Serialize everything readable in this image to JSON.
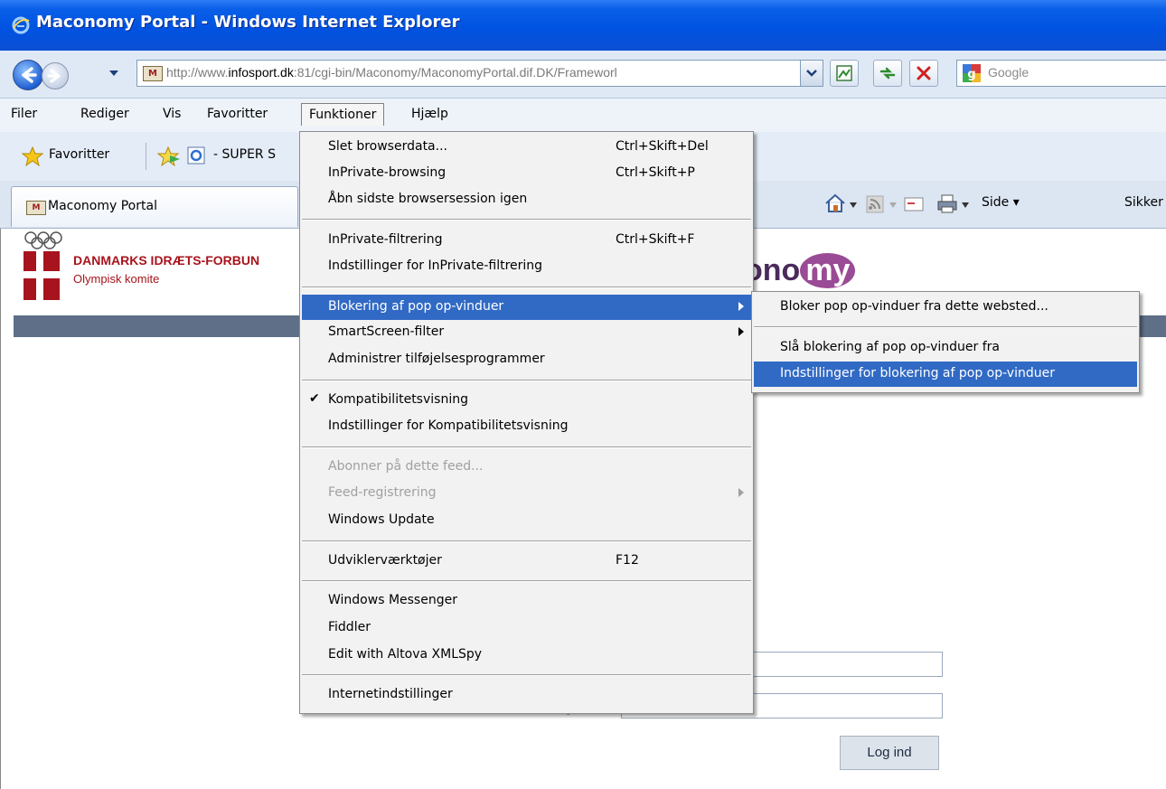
{
  "window": {
    "title": "Maconomy Portal - Windows Internet Explorer"
  },
  "address": {
    "url_prefix": "http://www.",
    "url_domain": "infosport.dk",
    "url_rest": ":81/cgi-bin/Maconomy/MaconomyPortal.dif.DK/Frameworl",
    "site_icon_text": "M",
    "search_placeholder": "Google"
  },
  "menubar": {
    "items": [
      "Filer",
      "Rediger",
      "Vis",
      "Favoritter",
      "Funktioner",
      "Hjælp"
    ]
  },
  "favorites": {
    "label": "Favoritter",
    "link": "- SUPER S"
  },
  "tab": {
    "label": "Maconomy Portal",
    "icon_text": "M"
  },
  "command_bar": {
    "page": "Side",
    "safety": "Sikker"
  },
  "page": {
    "org_name": "DANMARKS IDRÆTS-FORBUN",
    "org_sub": "Olympisk komite",
    "logo_prefix": "ono",
    "logo_suffix": "my",
    "login_button": "Log ind",
    "password_label_fragment": "g"
  },
  "menu": {
    "items": [
      {
        "label": "Slet browserdata...",
        "shortcut": "Ctrl+Skift+Del"
      },
      {
        "label": "InPrivate-browsing",
        "shortcut": "Ctrl+Skift+P"
      },
      {
        "label": "Åbn sidste browsersession igen",
        "shortcut": ""
      },
      {
        "label": "InPrivate-filtrering",
        "shortcut": "Ctrl+Skift+F"
      },
      {
        "label": "Indstillinger for InPrivate-filtrering",
        "shortcut": ""
      },
      {
        "label": "Blokering af pop op-vinduer",
        "shortcut": ""
      },
      {
        "label": "SmartScreen-filter",
        "shortcut": ""
      },
      {
        "label": "Administrer tilføjelsesprogrammer",
        "shortcut": ""
      },
      {
        "label": "Kompatibilitetsvisning",
        "shortcut": ""
      },
      {
        "label": "Indstillinger for Kompatibilitetsvisning",
        "shortcut": ""
      },
      {
        "label": "Abonner på dette feed...",
        "shortcut": ""
      },
      {
        "label": "Feed-registrering",
        "shortcut": ""
      },
      {
        "label": "Windows Update",
        "shortcut": ""
      },
      {
        "label": "Udviklerværktøjer",
        "shortcut": "F12"
      },
      {
        "label": "Windows Messenger",
        "shortcut": ""
      },
      {
        "label": "Fiddler",
        "shortcut": ""
      },
      {
        "label": "Edit with Altova XMLSpy",
        "shortcut": ""
      },
      {
        "label": "Internetindstillinger",
        "shortcut": ""
      }
    ],
    "checked_icon": "checkmark-icon"
  },
  "submenu": {
    "items": [
      {
        "label": "Bloker pop op-vinduer fra dette websted..."
      },
      {
        "label": "Slå blokering af pop op-vinduer fra"
      },
      {
        "label": "Indstillinger for blokering af pop op-vinduer"
      }
    ]
  },
  "colors": {
    "highlight": "#316ac5",
    "title_blue": "#0053e1",
    "brand_red": "#a8141d"
  }
}
